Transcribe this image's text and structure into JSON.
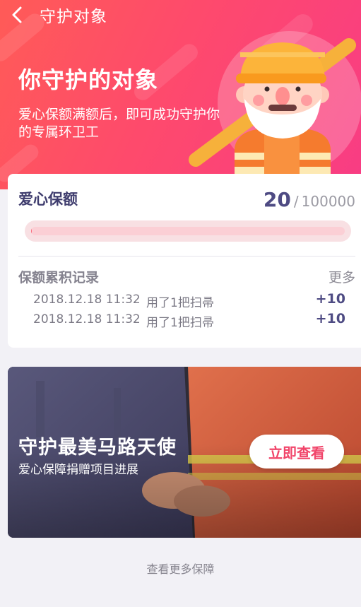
{
  "nav": {
    "title": "守护对象"
  },
  "hero": {
    "title": "你守护的对象",
    "subtitle": "爱心保额满额后，即可成功守护你的专属环卫工"
  },
  "coverage": {
    "title": "爱心保额",
    "current": "20",
    "separator": "/",
    "target": "100000",
    "progress_fraction": 0.0002
  },
  "records": {
    "title": "保额累积记录",
    "more_label": "更多",
    "items": [
      {
        "date": "2018.12.18 11:32",
        "desc": "用了1把扫帚",
        "points": "+10"
      },
      {
        "date": "2018.12.18 11:32",
        "desc": "用了1把扫帚",
        "points": "+10"
      }
    ]
  },
  "banner": {
    "title": "守护最美马路天使",
    "subtitle": "爱心保障捐赠项目进展",
    "button_label": "立即查看"
  },
  "footer": {
    "link_label": "查看更多保障"
  },
  "colors": {
    "hero_gradient_start": "#ff5b57",
    "hero_gradient_end": "#f83c84",
    "accent_text": "#4e4b83",
    "progress_track": "#f8e0e3",
    "button_text": "#f1456a"
  },
  "icons": {
    "back": "chevron-left-icon",
    "avatar": "street-sweeper-illustration"
  }
}
